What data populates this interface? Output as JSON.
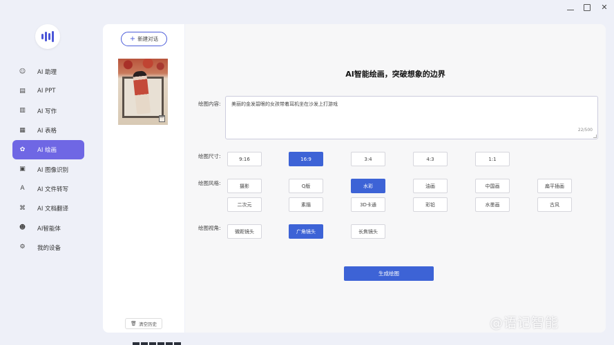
{
  "window": {
    "minimize": "—",
    "maximize": "□",
    "close": "✕"
  },
  "sidebar": {
    "items": [
      {
        "label": "AI 助理",
        "icon": "robot-icon",
        "glyph": "☺"
      },
      {
        "label": "AI PPT",
        "icon": "ppt-file-icon",
        "glyph": "▤"
      },
      {
        "label": "AI 写作",
        "icon": "document-icon",
        "glyph": "▥"
      },
      {
        "label": "AI 表格",
        "icon": "table-icon",
        "glyph": "▦"
      },
      {
        "label": "AI 绘画",
        "icon": "palette-icon",
        "glyph": "✿",
        "active": true
      },
      {
        "label": "AI 图像识别",
        "icon": "image-scan-icon",
        "glyph": "▣"
      },
      {
        "label": "AI 文件转写",
        "icon": "transcribe-icon",
        "glyph": "A"
      },
      {
        "label": "AI 文档翻译",
        "icon": "translate-icon",
        "glyph": "⌘"
      },
      {
        "label": "AI智能体",
        "icon": "agent-icon",
        "glyph": "☻"
      },
      {
        "label": "我的设备",
        "icon": "device-icon",
        "glyph": "⚙"
      }
    ]
  },
  "history": {
    "new_chat": "新建对话",
    "clear": "清空历史"
  },
  "main": {
    "title": "AI智能绘画，突破想象的边界",
    "prompt_label": "绘图内容:",
    "prompt_text": "美丽的金发碧眼的女孩带着耳机坐在沙发上打游戏",
    "prompt_count": "22/500",
    "size_label": "绘图尺寸:",
    "sizes": [
      "9:16",
      "16:9",
      "3:4",
      "4:3",
      "1:1"
    ],
    "style_label": "绘图风格:",
    "styles_row1": [
      "摄影",
      "Q版",
      "水彩",
      "油画",
      "中国画",
      "扁平插画"
    ],
    "styles_row2": [
      "二次元",
      "素描",
      "3D卡通",
      "彩铅",
      "水墨画",
      "古风"
    ],
    "view_label": "绘图视角:",
    "views": [
      "微距镜头",
      "广角镜头",
      "长焦镜头"
    ],
    "generate": "生成绘图"
  },
  "watermark": "@语记智能",
  "colors": {
    "accent": "#3d63d6",
    "active_nav": "#6f67e4"
  }
}
